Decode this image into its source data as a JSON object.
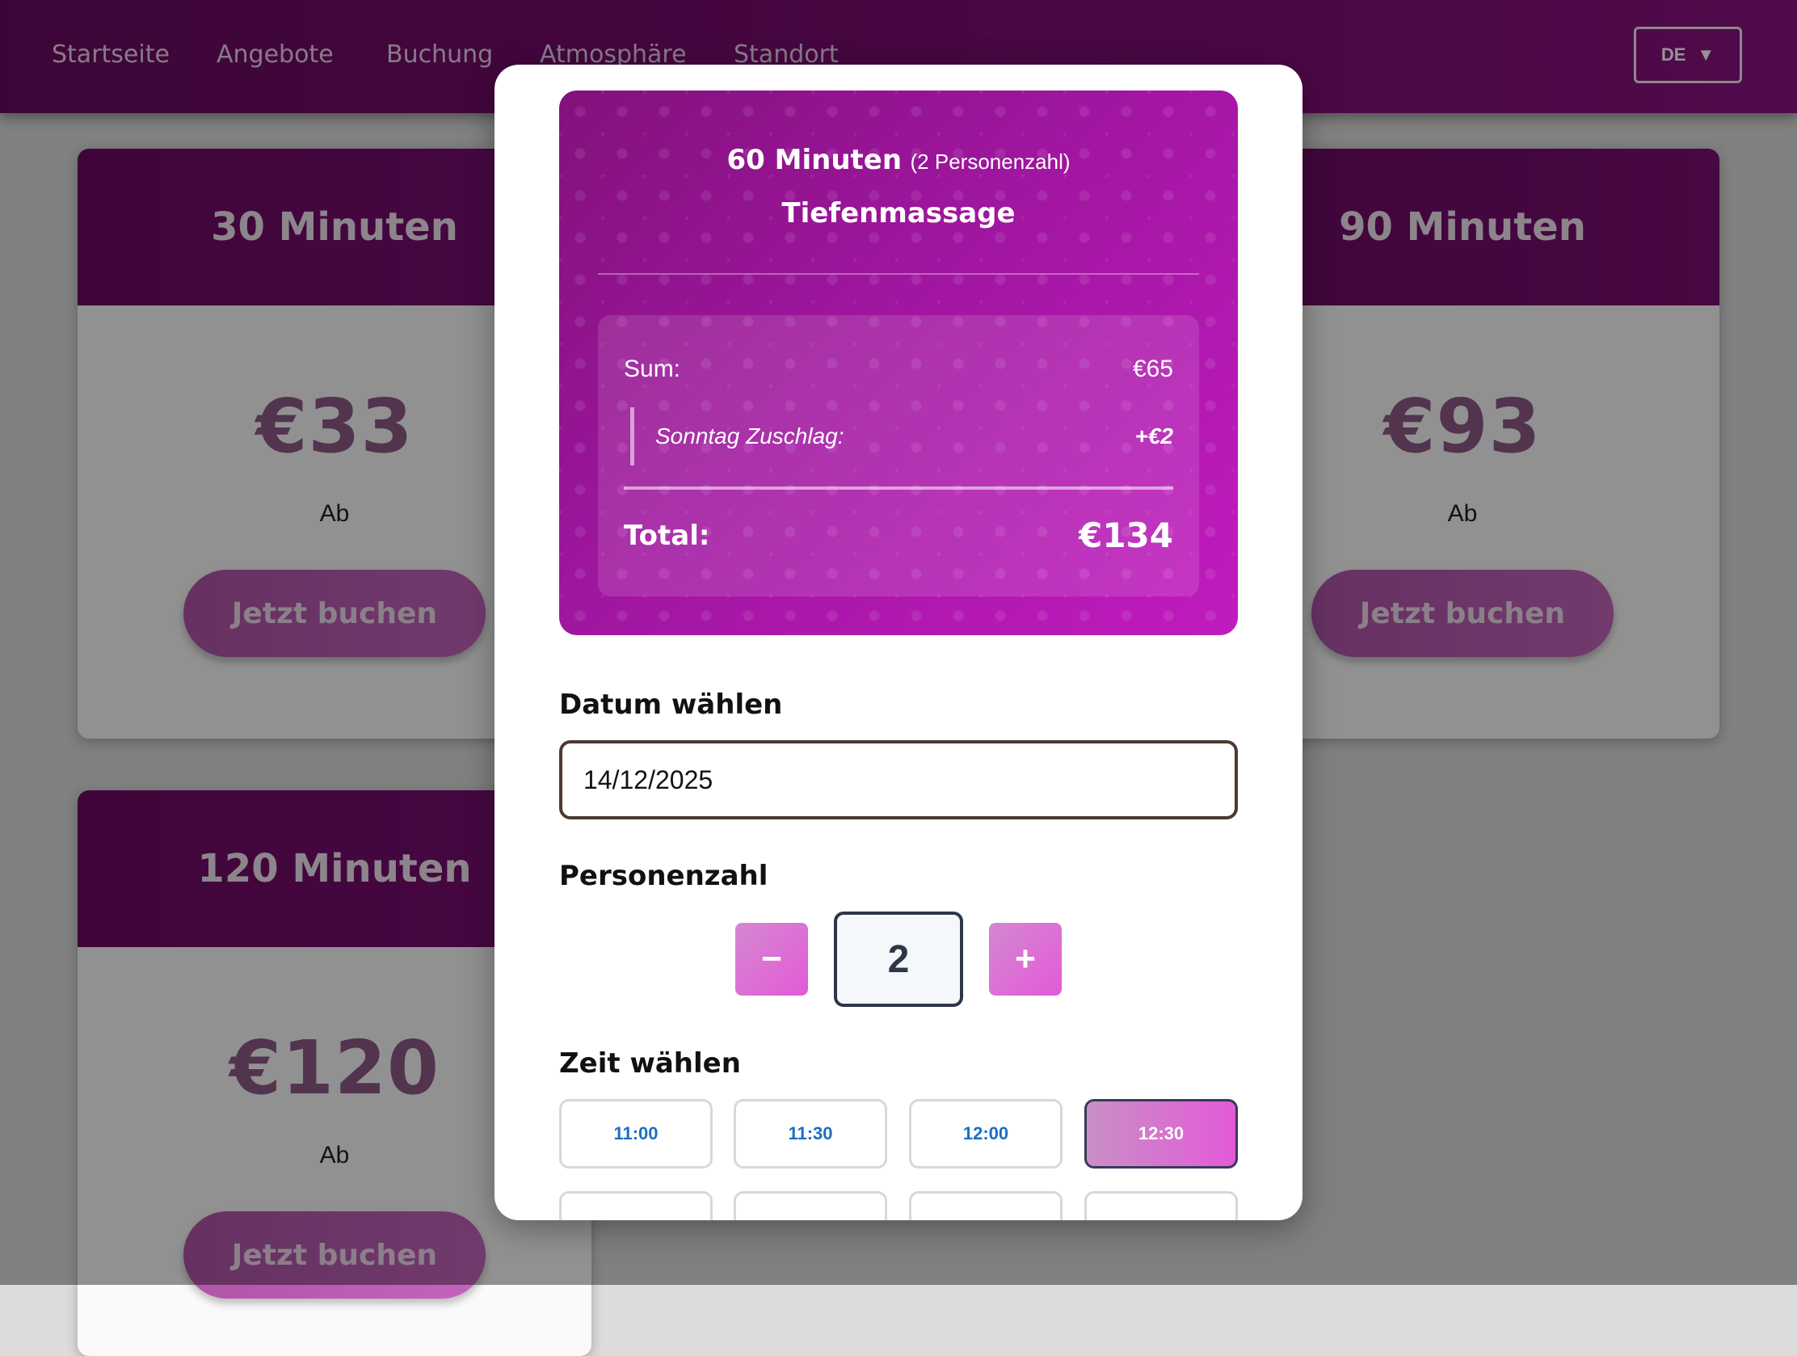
{
  "nav": {
    "links": [
      "Startseite",
      "Angebote",
      "Buchung",
      "Atmosphäre",
      "Standort"
    ],
    "lang": "DE"
  },
  "cards": [
    {
      "title": "30 Minuten",
      "price": "€33",
      "prefix": "Ab",
      "button": "Jetzt buchen"
    },
    {
      "title": "90 Minuten",
      "price": "€93",
      "prefix": "Ab",
      "button": "Jetzt buchen"
    },
    {
      "title": "120 Minuten",
      "price": "€120",
      "prefix": "Ab",
      "button": "Jetzt buchen"
    }
  ],
  "modal": {
    "summary": {
      "duration": "60 Minuten",
      "persons_note": "(2 Personenzahl)",
      "massage_type": "Tiefenmassage",
      "sum_label": "Sum:",
      "sum_value": "€65",
      "surcharge_label": "Sonntag Zuschlag:",
      "surcharge_value": "+€2",
      "total_label": "Total:",
      "total_value": "€134"
    },
    "date": {
      "label": "Datum wählen",
      "value": "14/12/2025"
    },
    "persons": {
      "label": "Personenzahl",
      "minus": "−",
      "plus": "+",
      "value": "2"
    },
    "time": {
      "label": "Zeit wählen",
      "slots": [
        "11:00",
        "11:30",
        "12:00",
        "12:30"
      ],
      "selected": "12:30"
    }
  },
  "colors": {
    "brand_purple": "#7a0d72",
    "accent_magenta": "#e35ad8",
    "slot_text": "#1a6fc4"
  }
}
